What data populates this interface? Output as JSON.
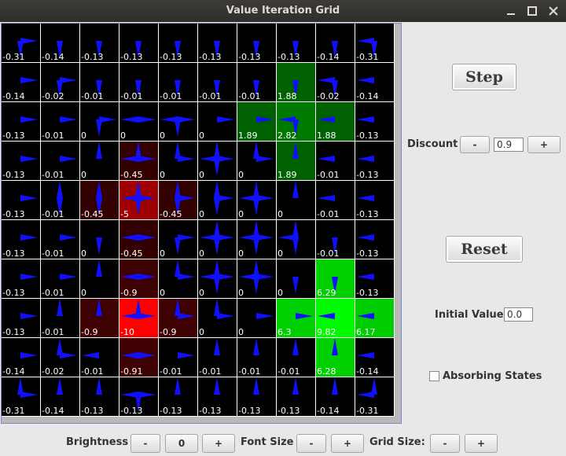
{
  "window": {
    "title": "Value Iteration Grid",
    "controls": [
      "minimize-icon",
      "maximize-icon",
      "close-icon"
    ]
  },
  "grid": {
    "size": 10,
    "colors": {
      "background": "#000000",
      "arrow": "#1010ff",
      "positive": "#00ff00",
      "negative": "#ff0000",
      "cell_border": "#ffffff"
    },
    "values": [
      [
        "-0.31",
        "-0.14",
        "-0.13",
        "-0.13",
        "-0.13",
        "-0.13",
        "-0.13",
        "-0.13",
        "-0.14",
        "-0.31"
      ],
      [
        "-0.14",
        "-0.02",
        "-0.01",
        "-0.01",
        "-0.01",
        "-0.01",
        "-0.01",
        "1.88",
        "-0.02",
        "-0.14"
      ],
      [
        "-0.13",
        "-0.01",
        "0",
        "0",
        "0",
        "0",
        "1.89",
        "2.82",
        "1.88",
        "-0.13"
      ],
      [
        "-0.13",
        "-0.01",
        "0",
        "-0.45",
        "0",
        "0",
        "0",
        "1.89",
        "-0.01",
        "-0.13"
      ],
      [
        "-0.13",
        "-0.01",
        "-0.45",
        "-5",
        "-0.45",
        "0",
        "0",
        "0",
        "-0.01",
        "-0.13"
      ],
      [
        "-0.13",
        "-0.01",
        "0",
        "-0.45",
        "0",
        "0",
        "0",
        "0",
        "-0.01",
        "-0.13"
      ],
      [
        "-0.13",
        "-0.01",
        "0",
        "-0.9",
        "0",
        "0",
        "0",
        "0",
        "6.29",
        "-0.13"
      ],
      [
        "-0.13",
        "-0.01",
        "-0.9",
        "-10",
        "-0.9",
        "0",
        "0",
        "6.3",
        "9.82",
        "6.17"
      ],
      [
        "-0.14",
        "-0.02",
        "-0.01",
        "-0.91",
        "-0.01",
        "-0.01",
        "-0.01",
        "-0.01",
        "6.28",
        "-0.14"
      ],
      [
        "-0.31",
        "-0.14",
        "-0.13",
        "-0.13",
        "-0.13",
        "-0.13",
        "-0.13",
        "-0.13",
        "-0.14",
        "-0.31"
      ]
    ]
  },
  "side": {
    "step_label": "Step",
    "discount_label": "Discount",
    "discount_minus": "-",
    "discount_value": "0.9",
    "discount_plus": "+",
    "reset_label": "Reset",
    "initial_value_label": "Initial Value",
    "initial_value": "0.0",
    "absorbing_label": "Absorbing States",
    "absorbing_checked": false
  },
  "bottom": {
    "brightness_label": "Brightness",
    "brightness_minus": "-",
    "brightness_value": "0",
    "brightness_plus": "+",
    "font_size_label": "Font Size",
    "font_minus": "-",
    "font_plus": "+",
    "grid_size_label": "Grid Size:",
    "grid_minus": "-",
    "grid_plus": "+"
  }
}
